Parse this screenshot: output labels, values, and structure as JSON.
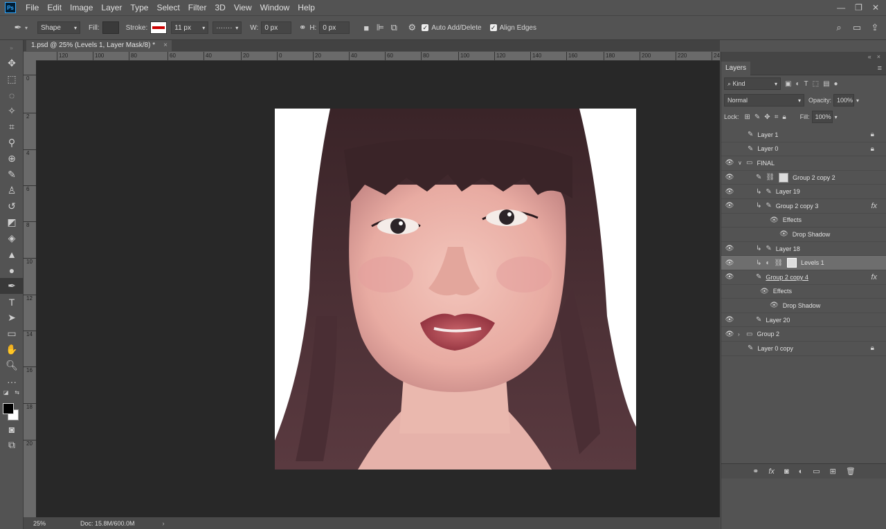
{
  "app": {
    "logo": "Ps"
  },
  "menu": [
    "File",
    "Edit",
    "Image",
    "Layer",
    "Type",
    "Select",
    "Filter",
    "3D",
    "View",
    "Window",
    "Help"
  ],
  "options": {
    "mode": "Shape",
    "fill_label": "Fill:",
    "stroke_label": "Stroke:",
    "stroke_width": "11 px",
    "w_label": "W:",
    "w_value": "0 px",
    "h_label": "H:",
    "h_value": "0 px",
    "auto_add_delete": "Auto Add/Delete",
    "align_edges": "Align Edges"
  },
  "document": {
    "tab_title": "1.psd @ 25% (Levels 1, Layer Mask/8) *",
    "zoom": "25%",
    "doc_size": "Doc: 15.8M/600.0M"
  },
  "ruler": {
    "h": [
      "120",
      "100",
      "80",
      "60",
      "40",
      "20",
      "0",
      "20",
      "40",
      "60",
      "80",
      "100",
      "120",
      "140",
      "160",
      "180",
      "200",
      "220",
      "240"
    ],
    "v": [
      "0",
      "2",
      "4",
      "6",
      "8",
      "10",
      "12",
      "14",
      "16",
      "18",
      "20"
    ]
  },
  "layers_panel": {
    "title": "Layers",
    "filter_kind": "Kind",
    "blend_mode": "Normal",
    "opacity_label": "Opacity:",
    "opacity_value": "100%",
    "lock_label": "Lock:",
    "fill_label": "Fill:",
    "fill_value": "100%",
    "layers": [
      {
        "name": "Layer 1",
        "visible": false,
        "locked": true,
        "indent": 0
      },
      {
        "name": "Layer 0",
        "visible": false,
        "locked": true,
        "indent": 0
      },
      {
        "name": "FINAL",
        "visible": true,
        "group": true,
        "expanded": true,
        "indent": 0
      },
      {
        "name": "Group 2 copy 2",
        "visible": true,
        "indent": 1
      },
      {
        "name": "Layer 19",
        "visible": true,
        "clipped": true,
        "indent": 1
      },
      {
        "name": "Group 2 copy 3",
        "visible": true,
        "clipped": true,
        "fx": true,
        "indent": 1
      },
      {
        "name": "Effects",
        "visible": true,
        "sub": true,
        "indent": 2
      },
      {
        "name": "Drop Shadow",
        "visible": true,
        "sub": true,
        "indent": 3
      },
      {
        "name": "Layer 18",
        "visible": true,
        "clipped": true,
        "indent": 1
      },
      {
        "name": "Levels 1",
        "visible": true,
        "clipped": true,
        "selected": true,
        "indent": 1
      },
      {
        "name": "Group 2 copy 4",
        "visible": true,
        "fx": true,
        "indent": 1
      },
      {
        "name": "Effects",
        "visible": true,
        "sub": true,
        "indent": 2
      },
      {
        "name": "Drop Shadow",
        "visible": true,
        "sub": true,
        "indent": 3
      },
      {
        "name": "Layer 20",
        "visible": true,
        "indent": 1
      },
      {
        "name": "Group 2",
        "visible": true,
        "group": true,
        "indent": 0
      },
      {
        "name": "Layer 0 copy",
        "visible": false,
        "locked": true,
        "indent": 0
      }
    ]
  }
}
